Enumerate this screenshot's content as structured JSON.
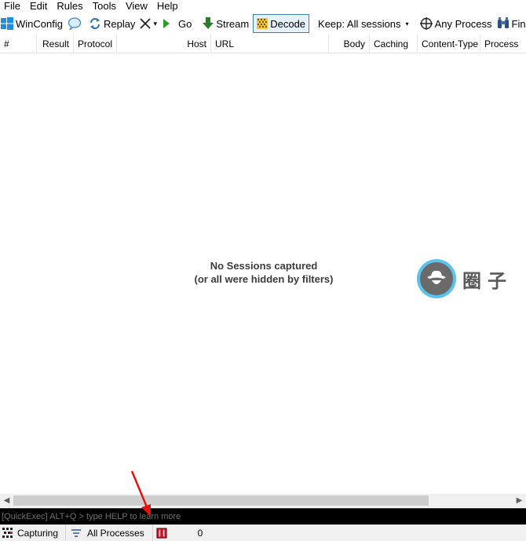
{
  "menu": [
    "File",
    "Edit",
    "Rules",
    "Tools",
    "View",
    "Help"
  ],
  "toolbar": {
    "winconfig": "WinConfig",
    "replay": "Replay",
    "remove_caret": "▾",
    "go": "Go",
    "stream": "Stream",
    "decode": "Decode",
    "keep": "Keep: All sessions",
    "keep_caret": "▾",
    "any_process": "Any Process",
    "find": "Find"
  },
  "columns": [
    "#",
    "Result",
    "Protocol",
    "Host",
    "URL",
    "Body",
    "Caching",
    "Content-Type",
    "Process"
  ],
  "empty_state": {
    "line1": "No Sessions captured",
    "line2": "(or all were hidden by filters)"
  },
  "watermark": {
    "text": "圈子"
  },
  "quickexec": {
    "placeholder": "[QuickExec] ALT+Q > type HELP to learn more"
  },
  "status": {
    "capturing": "Capturing",
    "processes": "All Processes",
    "count": "0"
  },
  "colors": {
    "accent": "#3c7fb1",
    "annotation": "#e81010",
    "watermark": "#5bc2ee"
  }
}
